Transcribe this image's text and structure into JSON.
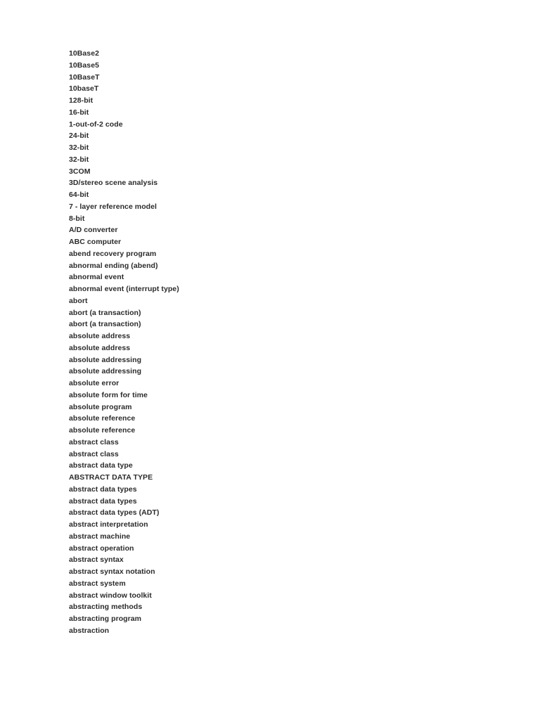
{
  "document": {
    "page_background": "#ffffff",
    "text_color": "#2b2b2b",
    "glossary_terms": [
      "10Base2",
      "10Base5",
      "10BaseT",
      "10baseT",
      "128-bit",
      "16-bit",
      "1-out-of-2 code",
      "24-bit",
      "32-bit",
      "32-bit",
      "3COM",
      "3D/stereo scene analysis",
      "64-bit",
      "7 - layer reference model",
      "8-bit",
      "A/D converter",
      "ABC computer",
      "abend recovery program",
      "abnormal ending (abend)",
      "abnormal event",
      "abnormal event (interrupt type)",
      "abort",
      "abort (a transaction)",
      "abort (a transaction)",
      "absolute address",
      "absolute address",
      "absolute addressing",
      "absolute addressing",
      "absolute error",
      "absolute form for time",
      "absolute program",
      "absolute reference",
      "absolute reference",
      "abstract class",
      "abstract class",
      "abstract data type",
      "ABSTRACT DATA TYPE",
      "abstract data types",
      "abstract data types",
      "abstract data types (ADT)",
      "abstract interpretation",
      "abstract machine",
      "abstract operation",
      "abstract syntax",
      "abstract syntax notation",
      "abstract system",
      "abstract window toolkit",
      "abstracting methods",
      "abstracting program",
      "abstraction"
    ]
  }
}
